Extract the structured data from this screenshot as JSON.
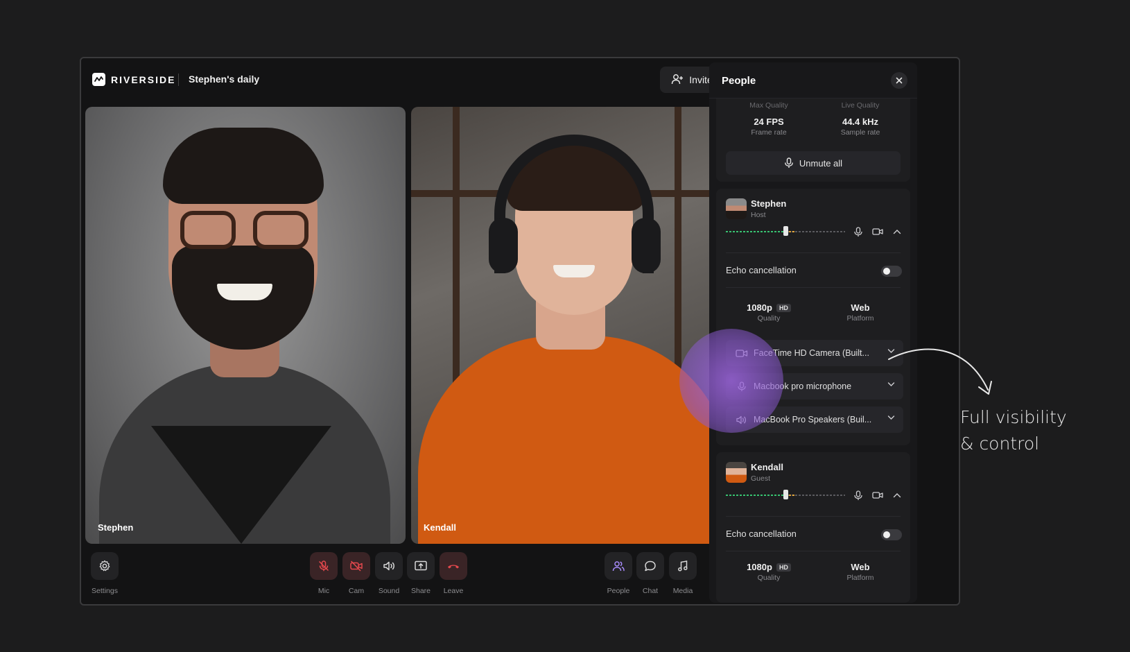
{
  "header": {
    "brand": "RIVERSIDE",
    "session_title": "Stephen's daily",
    "invite_label": "Invite"
  },
  "tiles": [
    {
      "name": "Stephen"
    },
    {
      "name": "Kendall"
    }
  ],
  "toolbar": {
    "settings_label": "Settings",
    "mic_label": "Mic",
    "cam_label": "Cam",
    "sound_label": "Sound",
    "share_label": "Share",
    "leave_label": "Leave",
    "people_label": "People",
    "chat_label": "Chat",
    "media_label": "Media"
  },
  "panel": {
    "title": "People",
    "stats": {
      "max_quality_label": "Max Quality",
      "live_quality_label": "Live Quality",
      "fps_value": "24 FPS",
      "fps_label": "Frame rate",
      "sample_value": "44.4 kHz",
      "sample_label": "Sample rate"
    },
    "unmute_all_label": "Unmute all",
    "participants": [
      {
        "name": "Stephen",
        "role": "Host",
        "volume_fraction": 0.5,
        "echo_label": "Echo cancellation",
        "echo_on": false,
        "quality_value": "1080p",
        "quality_badge": "HD",
        "quality_label": "Quality",
        "platform_value": "Web",
        "platform_label": "Platform",
        "camera_device": "FaceTime HD Camera (Built...",
        "mic_device": "Macbook pro microphone",
        "speaker_device": "MacBook Pro Speakers (Buil..."
      },
      {
        "name": "Kendall",
        "role": "Guest",
        "volume_fraction": 0.5,
        "echo_label": "Echo cancellation",
        "echo_on": false,
        "quality_value": "1080p",
        "quality_badge": "HD",
        "quality_label": "Quality",
        "platform_value": "Web",
        "platform_label": "Platform"
      }
    ]
  },
  "annotation": {
    "line1": "Full visibility",
    "line2": "& control"
  },
  "colors": {
    "background": "#1c1c1d",
    "accent_green": "#37c270",
    "accent_orange": "#e0a33a",
    "leave_red": "#e5484d",
    "glow_purple": "#9b64dc"
  }
}
